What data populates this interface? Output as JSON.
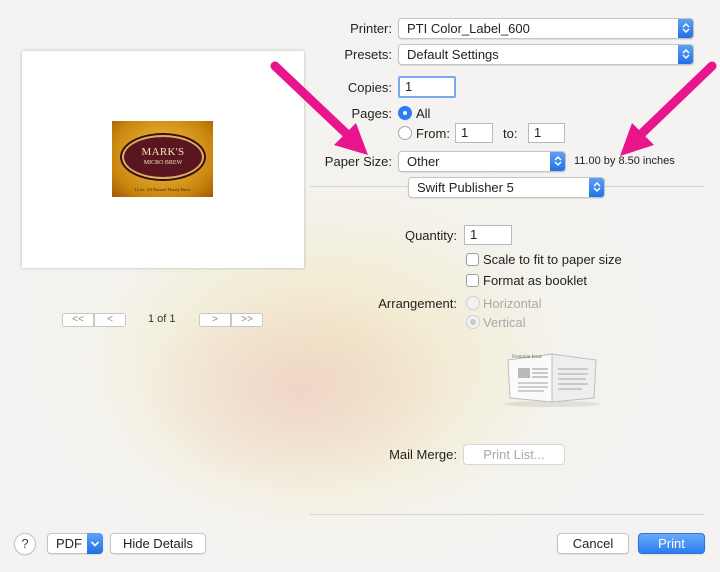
{
  "printer": {
    "label": "Printer:",
    "value": "PTI Color_Label_600"
  },
  "presets": {
    "label": "Presets:",
    "value": "Default Settings"
  },
  "copies": {
    "label": "Copies:",
    "value": "1"
  },
  "pages": {
    "label": "Pages:",
    "all_label": "All",
    "from_label": "From:",
    "from_value": "1",
    "to_label": "to:",
    "to_value": "1",
    "selected": "All"
  },
  "paper_size": {
    "label": "Paper Size:",
    "value": "Other",
    "dimensions": "11.00 by 8.50 inches"
  },
  "app_section": {
    "value": "Swift Publisher 5"
  },
  "preview": {
    "page_indicator": "1 of 1",
    "label_title": "MARK'S",
    "label_subtitle": "MICRO BREW",
    "label_footer": "12 oz. All Natural Honey Brew",
    "nav_first": "<<",
    "nav_prev": "<",
    "nav_next": ">",
    "nav_last": ">>"
  },
  "quantity": {
    "label": "Quantity:",
    "value": "1"
  },
  "scale_to_fit": {
    "label": "Scale to fit to paper size",
    "checked": false
  },
  "format_booklet": {
    "label": "Format as booklet",
    "checked": false
  },
  "arrangement": {
    "label": "Arrangement:",
    "horizontal_label": "Horizontal",
    "vertical_label": "Vertical",
    "selected": "Vertical"
  },
  "booklet_icon_text": "Premium Issue",
  "mail_merge": {
    "label": "Mail Merge:",
    "button_label": "Print List..."
  },
  "footer": {
    "help_label": "?",
    "pdf_label": "PDF",
    "hide_details_label": "Hide Details",
    "cancel_label": "Cancel",
    "print_label": "Print"
  },
  "colors": {
    "accent": "#2f7df6",
    "annotation_arrow": "#e8158c"
  }
}
